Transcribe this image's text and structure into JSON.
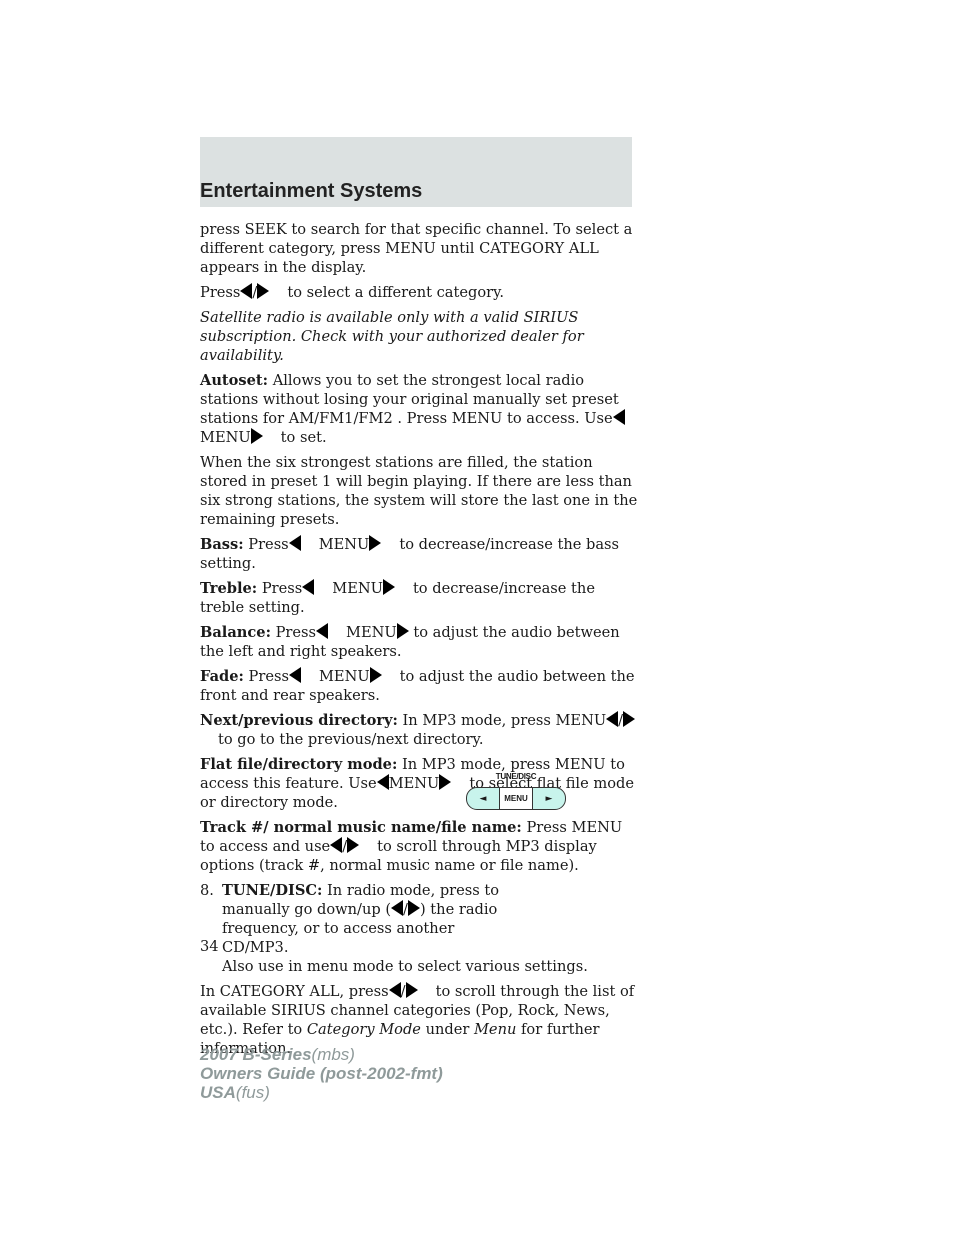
{
  "header": {
    "title": "Entertainment Systems"
  },
  "content": {
    "p1": "press SEEK to search for that specific channel. To select a different category, press MENU until CATEGORY ALL appears in the display.",
    "p2_pre": "Press",
    "p2_slash": "/",
    "p2_post": "to select a different category.",
    "note": "Satellite radio is available only with a valid SIRIUS subscription. Check with your authorized dealer for availability.",
    "autoset_label": "Autoset:",
    "autoset_text1": "Allows you to set the strongest local radio stations without losing your original manually set preset stations for AM/FM1/FM2 . Press MENU to access. Use",
    "menu": "MENU",
    "autoset_text2": "to set.",
    "p_six": "When the six strongest stations are filled, the station stored in preset 1 will begin playing. If there are less than six strong stations, the system will store the last one in the remaining presets.",
    "bass_label": "Bass:",
    "press": "Press",
    "bass_text": "to decrease/increase the bass setting.",
    "treble_label": "Treble:",
    "treble_text": "to decrease/increase the treble setting.",
    "balance_label": "Balance:",
    "balance_text": "to adjust the audio between the left and right speakers.",
    "fade_label": "Fade:",
    "fade_text": "to adjust the audio between the front and rear speakers.",
    "nextprev_label": "Next/previous directory:",
    "nextprev_pre": "In MP3 mode, press MENU",
    "nextprev_post": "to go to the previous/next directory.",
    "flat_label": "Flat file/directory mode:",
    "flat_pre": "In MP3 mode, press MENU to access this feature. Use",
    "flat_post": "to select flat file mode or directory mode.",
    "track_label": "Track #/ normal music name/file name:",
    "track_pre": "Press MENU to access and use",
    "track_post": "to scroll through MP3 display options (track #, normal music name or file name).",
    "item8_num": "8.",
    "item8_label": "TUNE/DISC:",
    "item8_text1": "In radio mode, press to manually go down/up (",
    "item8_text2": ") the radio frequency, or to access another CD/MP3.",
    "item8_text3": "Also use in menu mode to select various settings.",
    "cat_pre": "In CATEGORY ALL, press",
    "cat_mid": "to scroll through the list of available SIRIUS channel categories (Pop, Rock, News, etc.). Refer to",
    "cat_link1": "Category Mode",
    "cat_under": "under",
    "cat_link2": "Menu",
    "cat_end": "for further information."
  },
  "diagram": {
    "label": "TUNE/DISC",
    "left": "◄",
    "center": "MENU",
    "right": "►",
    "fill_color": "#c8f4ec"
  },
  "page_number": "34",
  "footer": {
    "line1_bold": "2007 B-Series",
    "line1_light": "(mbs)",
    "line2": "Owners Guide (post-2002-fmt)",
    "line3_bold": "USA",
    "line3_light": "(fus)"
  }
}
